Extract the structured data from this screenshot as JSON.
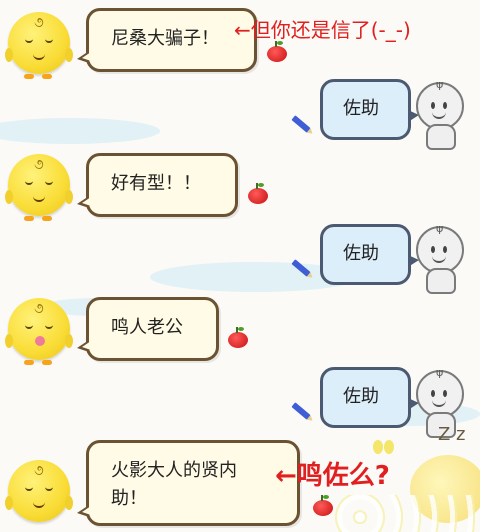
{
  "messages": [
    {
      "side": "left",
      "text": "尼桑大骗子！",
      "annotation": "←但你还是信了(-_-)"
    },
    {
      "side": "right",
      "text": "佐助"
    },
    {
      "side": "left",
      "text": "好有型！！"
    },
    {
      "side": "right",
      "text": "佐助"
    },
    {
      "side": "left",
      "text": "鸣人老公"
    },
    {
      "side": "right",
      "text": "佐助"
    },
    {
      "side": "left",
      "text_line1": "火影大人的贤内",
      "text_line2": "助！",
      "annotation": "←鸣佐么?"
    }
  ],
  "decor": {
    "sleep_z": "Z z"
  },
  "colors": {
    "annotation": "#e02020",
    "left_bubble": "#fffbe6",
    "right_bubble": "#dbeefa",
    "background": "#fbfaf6"
  }
}
